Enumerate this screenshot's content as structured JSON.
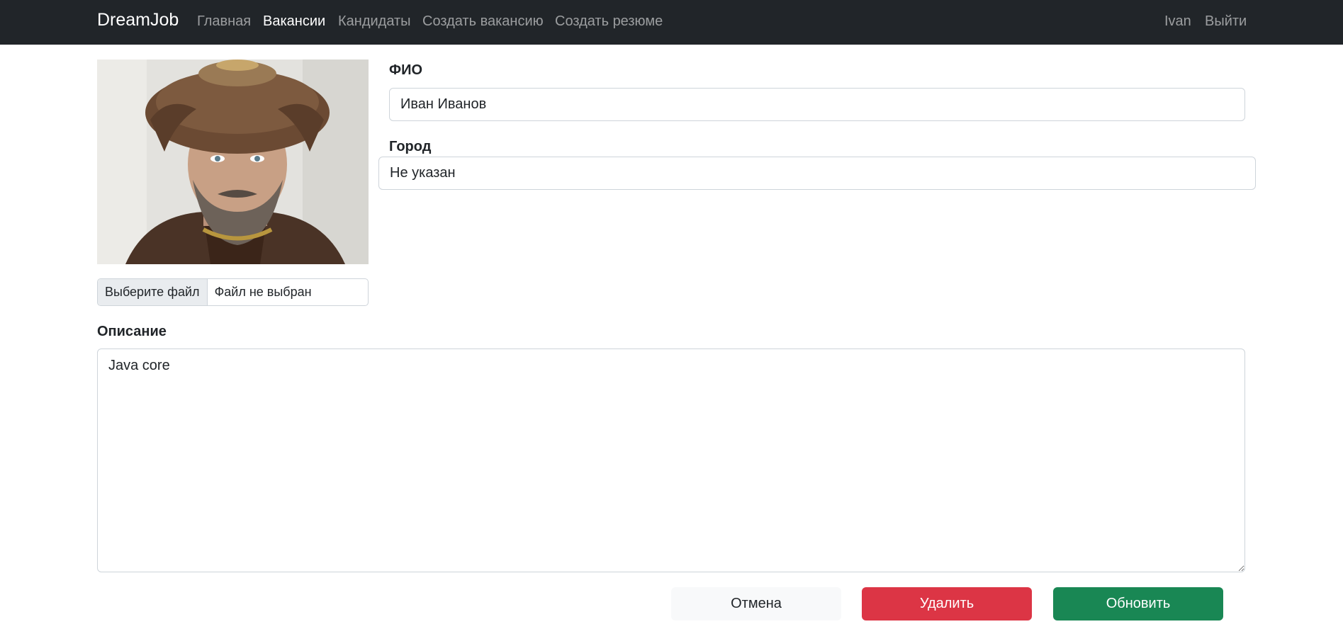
{
  "navbar": {
    "brand": "DreamJob",
    "links": [
      {
        "label": "Главная",
        "active": false
      },
      {
        "label": "Вакансии",
        "active": true
      },
      {
        "label": "Кандидаты",
        "active": false
      },
      {
        "label": "Создать вакансию",
        "active": false
      },
      {
        "label": "Создать резюме",
        "active": false
      }
    ],
    "user": "Ivan",
    "logout": "Выйти"
  },
  "photo": {
    "icon": "candidate-photo"
  },
  "file_input": {
    "button_label": "Выберите файл",
    "status": "Файл не выбран"
  },
  "form": {
    "name_label": "ФИО",
    "name_value": "Иван Иванов",
    "city_label": "Город",
    "city_value": "Не указан",
    "description_label": "Описание",
    "description_value": "Java core"
  },
  "actions": {
    "cancel": "Отмена",
    "delete": "Удалить",
    "update": "Обновить"
  },
  "colors": {
    "navbar_bg": "#212529",
    "delete_red": "#dc3545",
    "update_green": "#198754",
    "cancel_bg": "#f8f9fa"
  }
}
